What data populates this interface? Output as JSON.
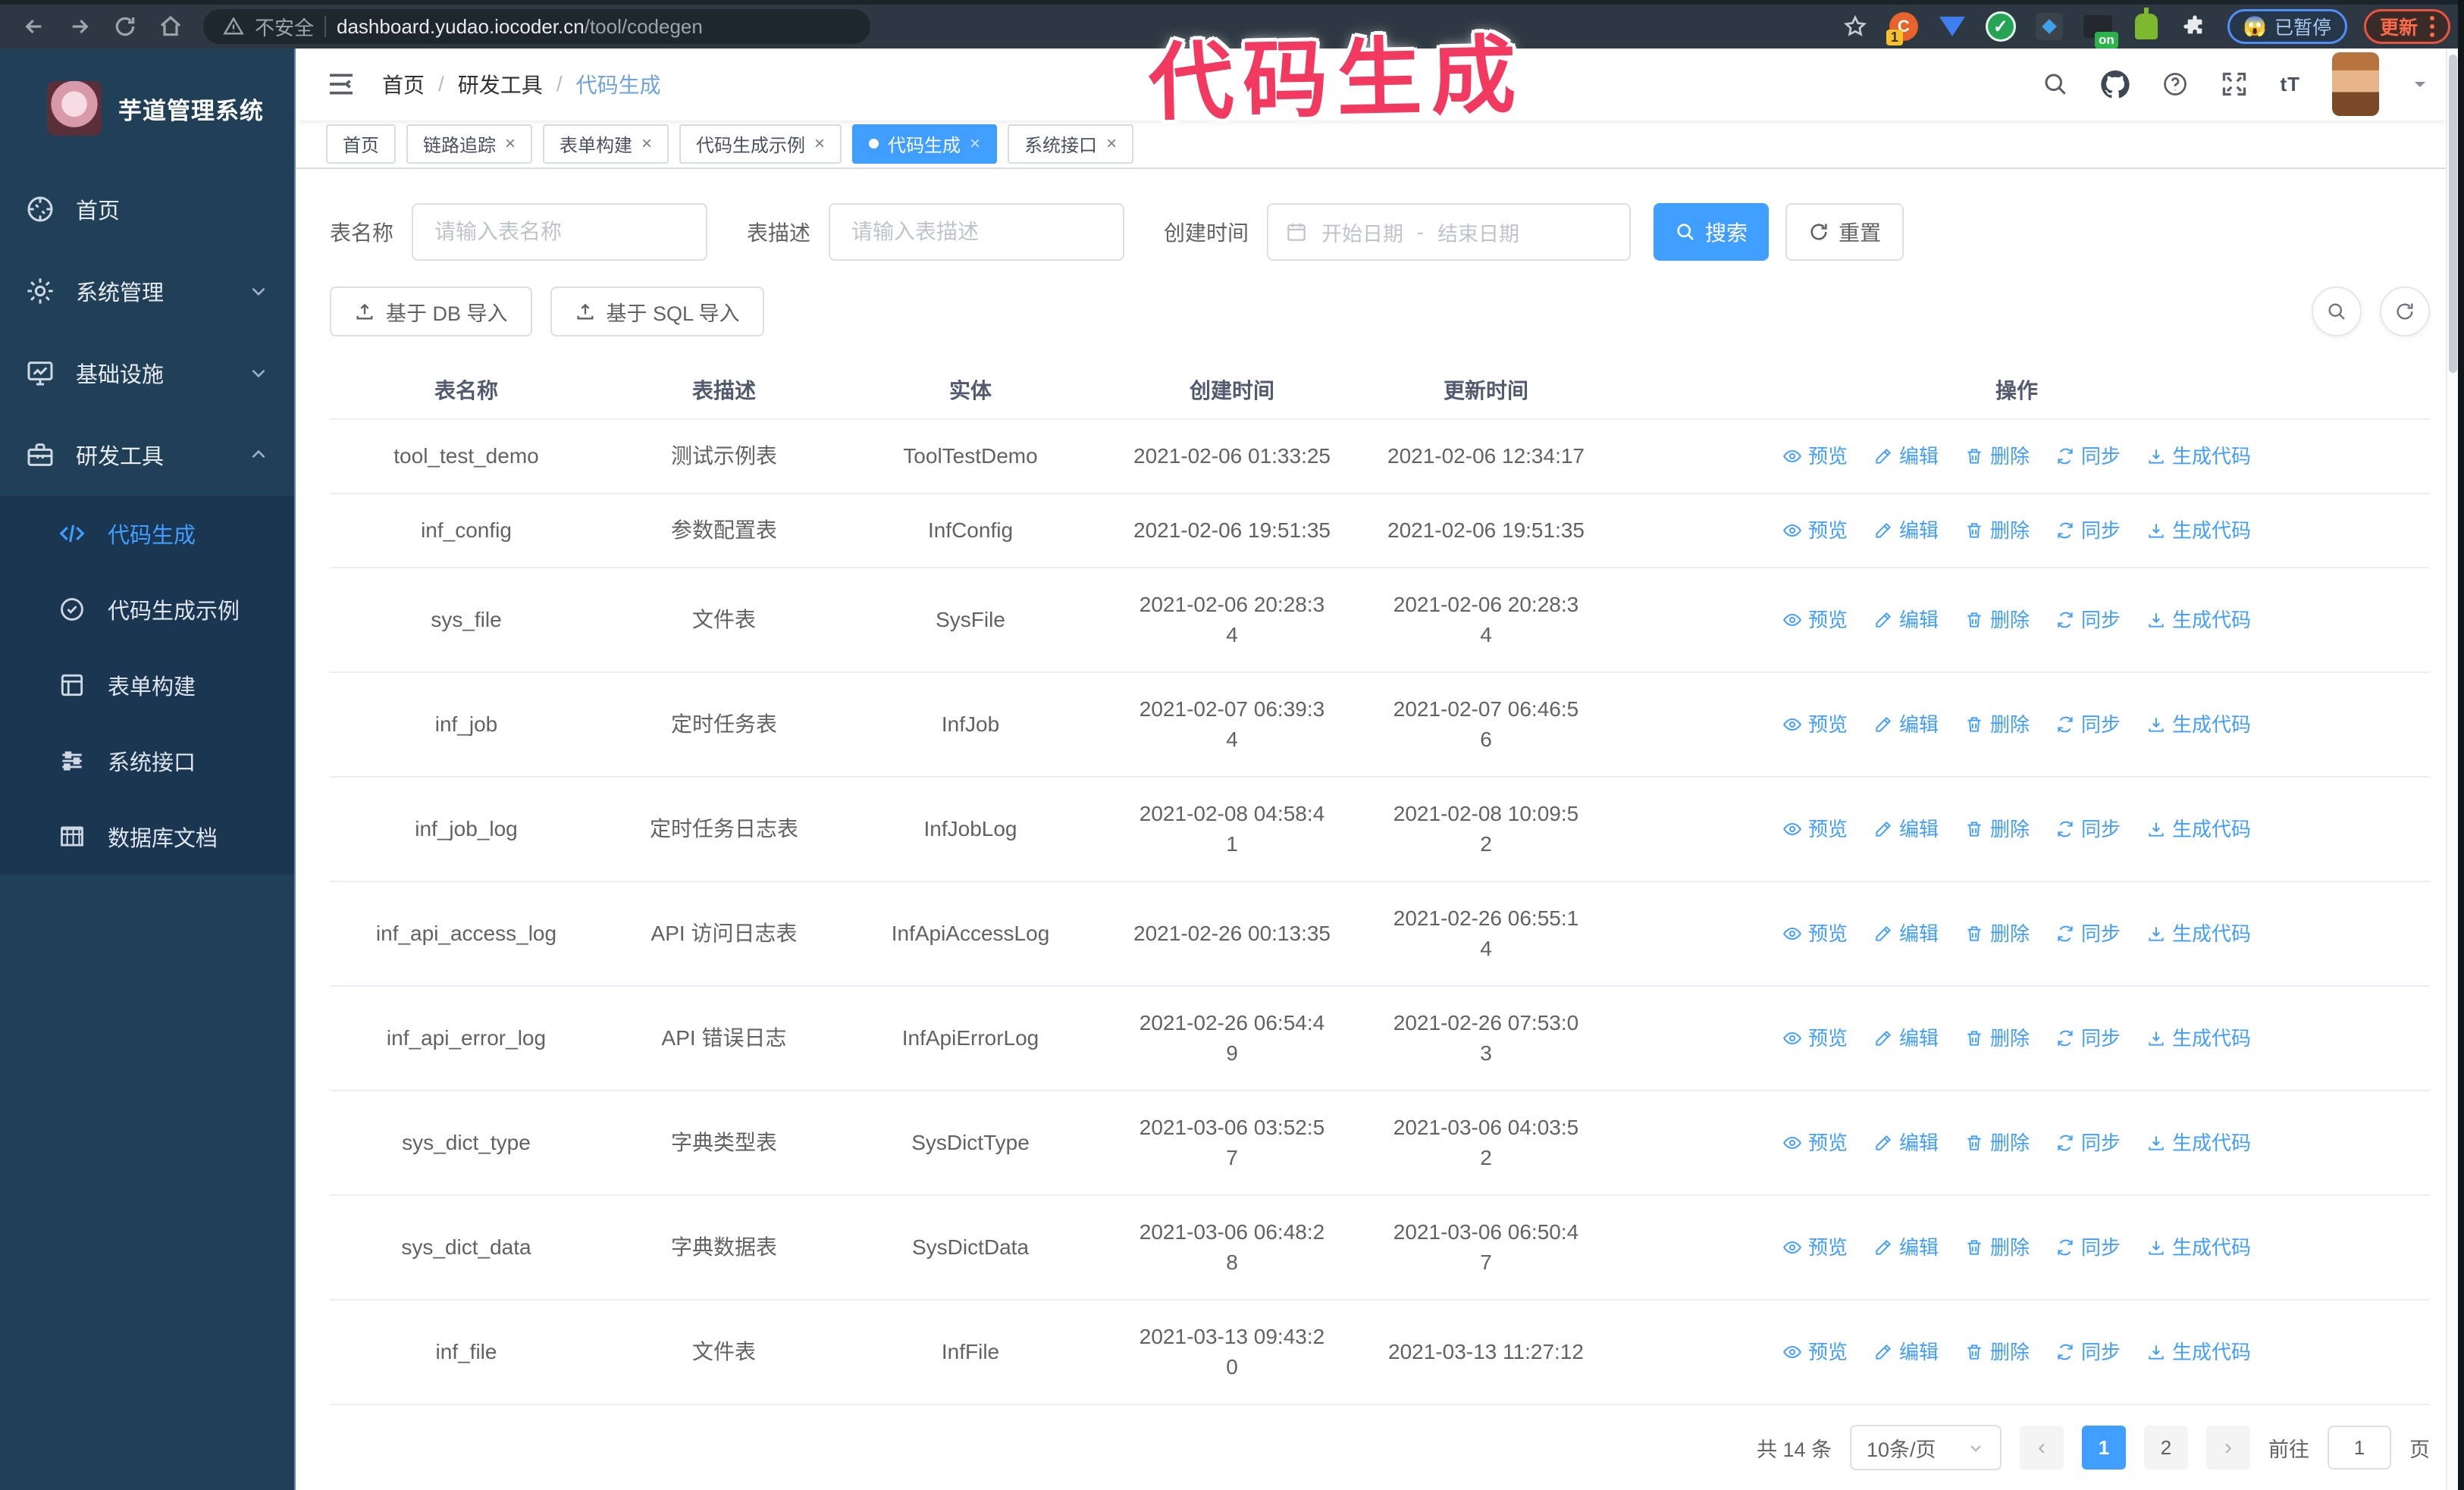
{
  "browser": {
    "security_label": "不安全",
    "url_host": "dashboard.yudao.iocoder.cn",
    "url_path": "/tool/codegen",
    "extension_badge_count": "1",
    "extension_badge_on": "on",
    "paused_emoji": "😱",
    "paused_badge": "已暂停",
    "update_button": "更新"
  },
  "annotation": {
    "text": "代码生成",
    "color": "#f2395f"
  },
  "sidebar": {
    "title": "芋道管理系统",
    "items": [
      {
        "label": "首页"
      },
      {
        "label": "系统管理"
      },
      {
        "label": "基础设施"
      },
      {
        "label": "研发工具"
      }
    ],
    "submenu": [
      {
        "label": "代码生成",
        "active": true
      },
      {
        "label": "代码生成示例"
      },
      {
        "label": "表单构建"
      },
      {
        "label": "系统接口"
      },
      {
        "label": "数据库文档"
      }
    ]
  },
  "breadcrumb": [
    "首页",
    "研发工具",
    "代码生成"
  ],
  "tabs": [
    {
      "label": "首页"
    },
    {
      "label": "链路追踪",
      "closable": true
    },
    {
      "label": "表单构建",
      "closable": true
    },
    {
      "label": "代码生成示例",
      "closable": true
    },
    {
      "label": "代码生成",
      "closable": true,
      "active": true
    },
    {
      "label": "系统接口",
      "closable": true
    }
  ],
  "filters": {
    "table_name_label": "表名称",
    "table_name_placeholder": "请输入表名称",
    "table_desc_label": "表描述",
    "table_desc_placeholder": "请输入表描述",
    "create_time_label": "创建时间",
    "date_start_placeholder": "开始日期",
    "date_separator": "-",
    "date_end_placeholder": "结束日期",
    "search_label": "搜索",
    "reset_label": "重置"
  },
  "toolbar": {
    "import_db_label": "基于 DB 导入",
    "import_sql_label": "基于 SQL 导入"
  },
  "table": {
    "columns": [
      "表名称",
      "表描述",
      "实体",
      "创建时间",
      "更新时间",
      "操作"
    ],
    "actions": [
      "预览",
      "编辑",
      "删除",
      "同步",
      "生成代码"
    ],
    "rows": [
      {
        "name": "tool_test_demo",
        "desc": "测试示例表",
        "entity": "ToolTestDemo",
        "created": [
          "2021-02-06 01:33:25"
        ],
        "updated": [
          "2021-02-06 12:34:17"
        ]
      },
      {
        "name": "inf_config",
        "desc": "参数配置表",
        "entity": "InfConfig",
        "created": [
          "2021-02-06 19:51:35"
        ],
        "updated": [
          "2021-02-06 19:51:35"
        ]
      },
      {
        "name": "sys_file",
        "desc": "文件表",
        "entity": "SysFile",
        "created": [
          "2021-02-06 20:28:3",
          "4"
        ],
        "updated": [
          "2021-02-06 20:28:3",
          "4"
        ]
      },
      {
        "name": "inf_job",
        "desc": "定时任务表",
        "entity": "InfJob",
        "created": [
          "2021-02-07 06:39:3",
          "4"
        ],
        "updated": [
          "2021-02-07 06:46:5",
          "6"
        ]
      },
      {
        "name": "inf_job_log",
        "desc": "定时任务日志表",
        "entity": "InfJobLog",
        "created": [
          "2021-02-08 04:58:4",
          "1"
        ],
        "updated": [
          "2021-02-08 10:09:5",
          "2"
        ]
      },
      {
        "name": "inf_api_access_log",
        "desc": "API 访问日志表",
        "entity": "InfApiAccessLog",
        "created": [
          "2021-02-26 00:13:35"
        ],
        "updated": [
          "2021-02-26 06:55:1",
          "4"
        ]
      },
      {
        "name": "inf_api_error_log",
        "desc": "API 错误日志",
        "entity": "InfApiErrorLog",
        "created": [
          "2021-02-26 06:54:4",
          "9"
        ],
        "updated": [
          "2021-02-26 07:53:0",
          "3"
        ]
      },
      {
        "name": "sys_dict_type",
        "desc": "字典类型表",
        "entity": "SysDictType",
        "created": [
          "2021-03-06 03:52:5",
          "7"
        ],
        "updated": [
          "2021-03-06 04:03:5",
          "2"
        ]
      },
      {
        "name": "sys_dict_data",
        "desc": "字典数据表",
        "entity": "SysDictData",
        "created": [
          "2021-03-06 06:48:2",
          "8"
        ],
        "updated": [
          "2021-03-06 06:50:4",
          "7"
        ]
      },
      {
        "name": "inf_file",
        "desc": "文件表",
        "entity": "InfFile",
        "created": [
          "2021-03-13 09:43:2",
          "0"
        ],
        "updated": [
          "2021-03-13 11:27:12"
        ]
      }
    ]
  },
  "pagination": {
    "total_label": "共 14 条",
    "page_size": "10条/页",
    "pages": [
      "1",
      "2"
    ],
    "active_page": "1",
    "goto_label": "前往",
    "goto_value": "1",
    "goto_suffix": "页"
  },
  "colors": {
    "accent_blue": "#409eff",
    "sidebar_bg": "#204058",
    "submenu_bg": "#1a3650",
    "chrome_bg": "#2e3842",
    "annotation_pink": "#f2395f",
    "update_red": "#e8543f",
    "paused_blue": "#4e8ef7",
    "border_gray": "#dcdfe6",
    "text_gray": "#606266"
  },
  "icons": {
    "browser": [
      "back",
      "forward",
      "reload",
      "home",
      "warning-triangle",
      "bookmark-star",
      "puzzle",
      "kebab-menu"
    ],
    "header": [
      "search",
      "github",
      "help-circle",
      "fullscreen",
      "font-size",
      "caret-down"
    ],
    "sidebar": [
      "dashboard",
      "gear",
      "monitor",
      "toolbox",
      "code",
      "badge-check",
      "form",
      "sliders",
      "db-table",
      "chevron-down",
      "chevron-up"
    ],
    "actions": [
      "eye",
      "pencil",
      "trash",
      "sync",
      "download"
    ],
    "misc": [
      "calendar",
      "upload",
      "refresh",
      "magnifier"
    ]
  }
}
